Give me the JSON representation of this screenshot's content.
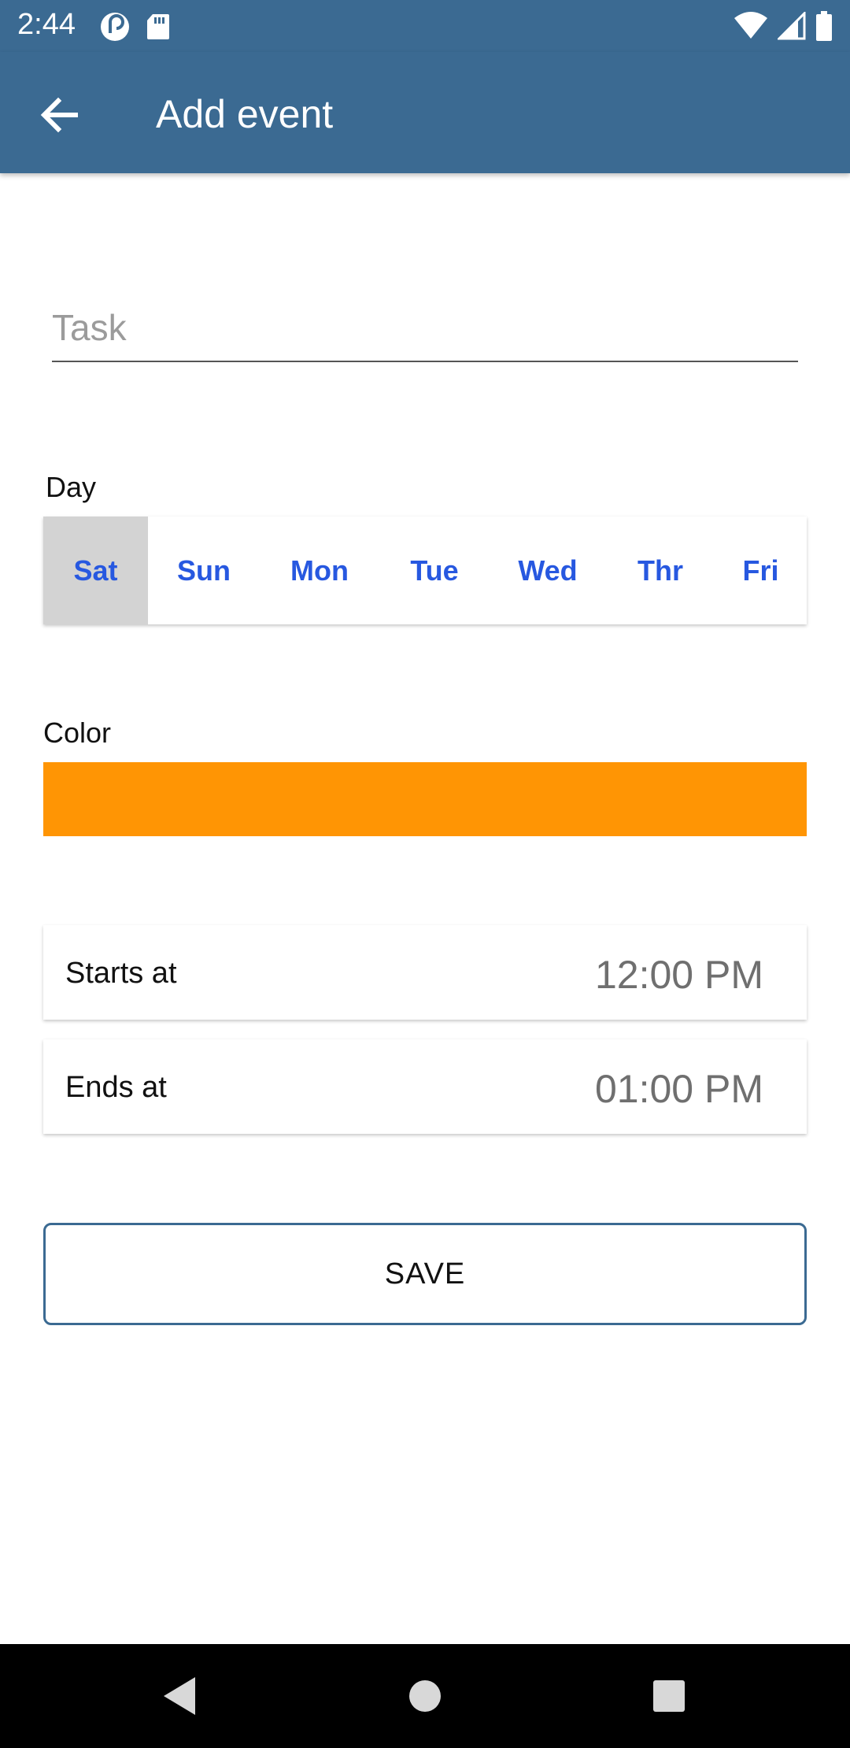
{
  "status_bar": {
    "time": "2:44",
    "left_icons": [
      "pocket-casts-icon",
      "sd-card-icon"
    ],
    "right_icons": [
      "wifi-icon",
      "signal-icon",
      "battery-icon"
    ]
  },
  "app_bar": {
    "title": "Add event",
    "back_icon": "arrow-back-icon",
    "color": "#3b6a92"
  },
  "task": {
    "placeholder": "Task",
    "value": ""
  },
  "day": {
    "label": "Day",
    "options": [
      "Sat",
      "Sun",
      "Mon",
      "Tue",
      "Wed",
      "Thr",
      "Fri"
    ],
    "selected": "Sat",
    "accent_color": "#2758e0"
  },
  "color": {
    "label": "Color",
    "value": "#ff9504"
  },
  "starts_at": {
    "label": "Starts at",
    "value": "12:00 PM"
  },
  "ends_at": {
    "label": "Ends at",
    "value": "01:00 PM"
  },
  "save_label": "SAVE",
  "nav_bar": {
    "icons": [
      "nav-back-icon",
      "nav-home-icon",
      "nav-recents-icon"
    ]
  }
}
